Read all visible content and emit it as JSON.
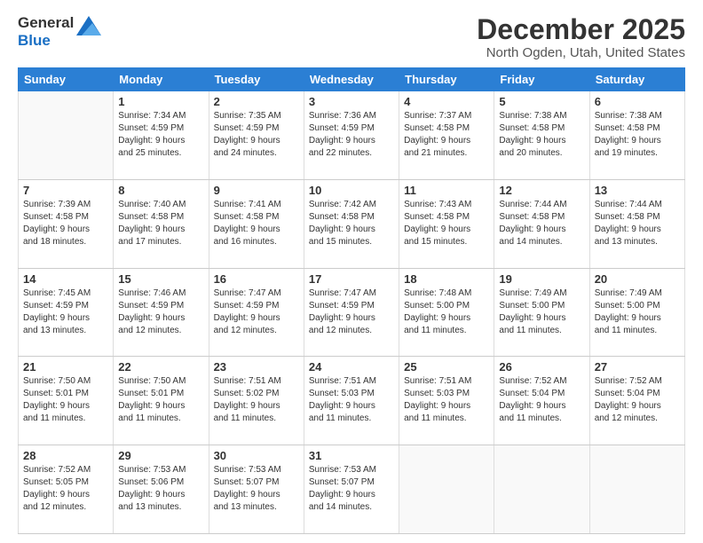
{
  "logo": {
    "line1": "General",
    "line2": "Blue"
  },
  "title": "December 2025",
  "location": "North Ogden, Utah, United States",
  "days_header": [
    "Sunday",
    "Monday",
    "Tuesday",
    "Wednesday",
    "Thursday",
    "Friday",
    "Saturday"
  ],
  "weeks": [
    [
      {
        "day": "",
        "info": ""
      },
      {
        "day": "1",
        "info": "Sunrise: 7:34 AM\nSunset: 4:59 PM\nDaylight: 9 hours\nand 25 minutes."
      },
      {
        "day": "2",
        "info": "Sunrise: 7:35 AM\nSunset: 4:59 PM\nDaylight: 9 hours\nand 24 minutes."
      },
      {
        "day": "3",
        "info": "Sunrise: 7:36 AM\nSunset: 4:59 PM\nDaylight: 9 hours\nand 22 minutes."
      },
      {
        "day": "4",
        "info": "Sunrise: 7:37 AM\nSunset: 4:58 PM\nDaylight: 9 hours\nand 21 minutes."
      },
      {
        "day": "5",
        "info": "Sunrise: 7:38 AM\nSunset: 4:58 PM\nDaylight: 9 hours\nand 20 minutes."
      },
      {
        "day": "6",
        "info": "Sunrise: 7:38 AM\nSunset: 4:58 PM\nDaylight: 9 hours\nand 19 minutes."
      }
    ],
    [
      {
        "day": "7",
        "info": "Sunrise: 7:39 AM\nSunset: 4:58 PM\nDaylight: 9 hours\nand 18 minutes."
      },
      {
        "day": "8",
        "info": "Sunrise: 7:40 AM\nSunset: 4:58 PM\nDaylight: 9 hours\nand 17 minutes."
      },
      {
        "day": "9",
        "info": "Sunrise: 7:41 AM\nSunset: 4:58 PM\nDaylight: 9 hours\nand 16 minutes."
      },
      {
        "day": "10",
        "info": "Sunrise: 7:42 AM\nSunset: 4:58 PM\nDaylight: 9 hours\nand 15 minutes."
      },
      {
        "day": "11",
        "info": "Sunrise: 7:43 AM\nSunset: 4:58 PM\nDaylight: 9 hours\nand 15 minutes."
      },
      {
        "day": "12",
        "info": "Sunrise: 7:44 AM\nSunset: 4:58 PM\nDaylight: 9 hours\nand 14 minutes."
      },
      {
        "day": "13",
        "info": "Sunrise: 7:44 AM\nSunset: 4:58 PM\nDaylight: 9 hours\nand 13 minutes."
      }
    ],
    [
      {
        "day": "14",
        "info": "Sunrise: 7:45 AM\nSunset: 4:59 PM\nDaylight: 9 hours\nand 13 minutes."
      },
      {
        "day": "15",
        "info": "Sunrise: 7:46 AM\nSunset: 4:59 PM\nDaylight: 9 hours\nand 12 minutes."
      },
      {
        "day": "16",
        "info": "Sunrise: 7:47 AM\nSunset: 4:59 PM\nDaylight: 9 hours\nand 12 minutes."
      },
      {
        "day": "17",
        "info": "Sunrise: 7:47 AM\nSunset: 4:59 PM\nDaylight: 9 hours\nand 12 minutes."
      },
      {
        "day": "18",
        "info": "Sunrise: 7:48 AM\nSunset: 5:00 PM\nDaylight: 9 hours\nand 11 minutes."
      },
      {
        "day": "19",
        "info": "Sunrise: 7:49 AM\nSunset: 5:00 PM\nDaylight: 9 hours\nand 11 minutes."
      },
      {
        "day": "20",
        "info": "Sunrise: 7:49 AM\nSunset: 5:00 PM\nDaylight: 9 hours\nand 11 minutes."
      }
    ],
    [
      {
        "day": "21",
        "info": "Sunrise: 7:50 AM\nSunset: 5:01 PM\nDaylight: 9 hours\nand 11 minutes."
      },
      {
        "day": "22",
        "info": "Sunrise: 7:50 AM\nSunset: 5:01 PM\nDaylight: 9 hours\nand 11 minutes."
      },
      {
        "day": "23",
        "info": "Sunrise: 7:51 AM\nSunset: 5:02 PM\nDaylight: 9 hours\nand 11 minutes."
      },
      {
        "day": "24",
        "info": "Sunrise: 7:51 AM\nSunset: 5:03 PM\nDaylight: 9 hours\nand 11 minutes."
      },
      {
        "day": "25",
        "info": "Sunrise: 7:51 AM\nSunset: 5:03 PM\nDaylight: 9 hours\nand 11 minutes."
      },
      {
        "day": "26",
        "info": "Sunrise: 7:52 AM\nSunset: 5:04 PM\nDaylight: 9 hours\nand 11 minutes."
      },
      {
        "day": "27",
        "info": "Sunrise: 7:52 AM\nSunset: 5:04 PM\nDaylight: 9 hours\nand 12 minutes."
      }
    ],
    [
      {
        "day": "28",
        "info": "Sunrise: 7:52 AM\nSunset: 5:05 PM\nDaylight: 9 hours\nand 12 minutes."
      },
      {
        "day": "29",
        "info": "Sunrise: 7:53 AM\nSunset: 5:06 PM\nDaylight: 9 hours\nand 13 minutes."
      },
      {
        "day": "30",
        "info": "Sunrise: 7:53 AM\nSunset: 5:07 PM\nDaylight: 9 hours\nand 13 minutes."
      },
      {
        "day": "31",
        "info": "Sunrise: 7:53 AM\nSunset: 5:07 PM\nDaylight: 9 hours\nand 14 minutes."
      },
      {
        "day": "",
        "info": ""
      },
      {
        "day": "",
        "info": ""
      },
      {
        "day": "",
        "info": ""
      }
    ]
  ]
}
